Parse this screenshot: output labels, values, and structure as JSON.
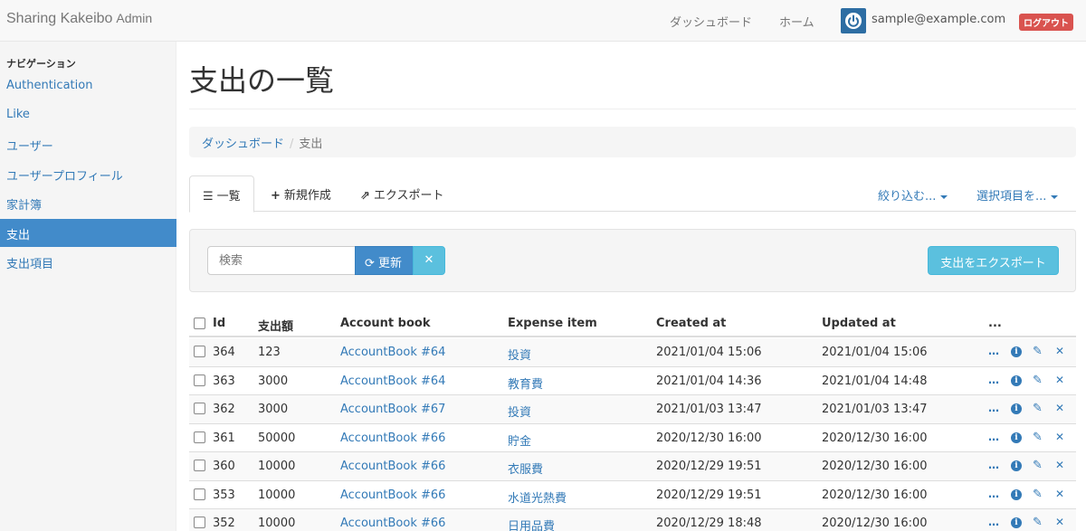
{
  "navbar": {
    "brand": "Sharing Kakeibo",
    "brand_sub": "Admin",
    "links": [
      "ダッシュボード",
      "ホーム"
    ],
    "user_email": "sample@example.com",
    "logout": "ログアウト"
  },
  "sidebar": {
    "heading": "ナビゲーション",
    "items": [
      {
        "label": "Authentication",
        "active": false
      },
      {
        "label": "Like",
        "active": false
      },
      {
        "label": "ユーザー",
        "active": false
      },
      {
        "label": "ユーザープロフィール",
        "active": false
      },
      {
        "label": "家計簿",
        "active": false
      },
      {
        "label": "支出",
        "active": true
      },
      {
        "label": "支出項目",
        "active": false
      }
    ]
  },
  "main": {
    "title": "支出の一覧",
    "breadcrumb": {
      "parent": "ダッシュボード",
      "current": "支出"
    },
    "tabs": {
      "list": "一覧",
      "new": "新規作成",
      "export": "エクスポート",
      "filter": "絞り込む...",
      "selected": "選択項目を..."
    },
    "search_placeholder": "検索",
    "refresh": "更新",
    "clear": "✕",
    "export_button": "支出をエクスポート"
  },
  "table": {
    "headers": {
      "id": "Id",
      "amount": "支出額",
      "account_book": "Account book",
      "expense_item": "Expense item",
      "created_at": "Created at",
      "updated_at": "Updated at",
      "actions": "..."
    },
    "rows": [
      {
        "id": "364",
        "amount": "123",
        "account_book": "AccountBook #64",
        "expense_item": "投資",
        "created_at": "2021/01/04 15:06",
        "updated_at": "2021/01/04 15:06"
      },
      {
        "id": "363",
        "amount": "3000",
        "account_book": "AccountBook #64",
        "expense_item": "教育費",
        "created_at": "2021/01/04 14:36",
        "updated_at": "2021/01/04 14:48"
      },
      {
        "id": "362",
        "amount": "3000",
        "account_book": "AccountBook #67",
        "expense_item": "投資",
        "created_at": "2021/01/03 13:47",
        "updated_at": "2021/01/03 13:47"
      },
      {
        "id": "361",
        "amount": "50000",
        "account_book": "AccountBook #66",
        "expense_item": "貯金",
        "created_at": "2020/12/30 16:00",
        "updated_at": "2020/12/30 16:00"
      },
      {
        "id": "360",
        "amount": "10000",
        "account_book": "AccountBook #66",
        "expense_item": "衣服費",
        "created_at": "2020/12/29 19:51",
        "updated_at": "2020/12/30 16:00"
      },
      {
        "id": "353",
        "amount": "10000",
        "account_book": "AccountBook #66",
        "expense_item": "水道光熱費",
        "created_at": "2020/12/29 19:51",
        "updated_at": "2020/12/30 16:00"
      },
      {
        "id": "352",
        "amount": "10000",
        "account_book": "AccountBook #66",
        "expense_item": "日用品費",
        "created_at": "2020/12/29 18:48",
        "updated_at": "2020/12/30 16:00"
      }
    ]
  }
}
